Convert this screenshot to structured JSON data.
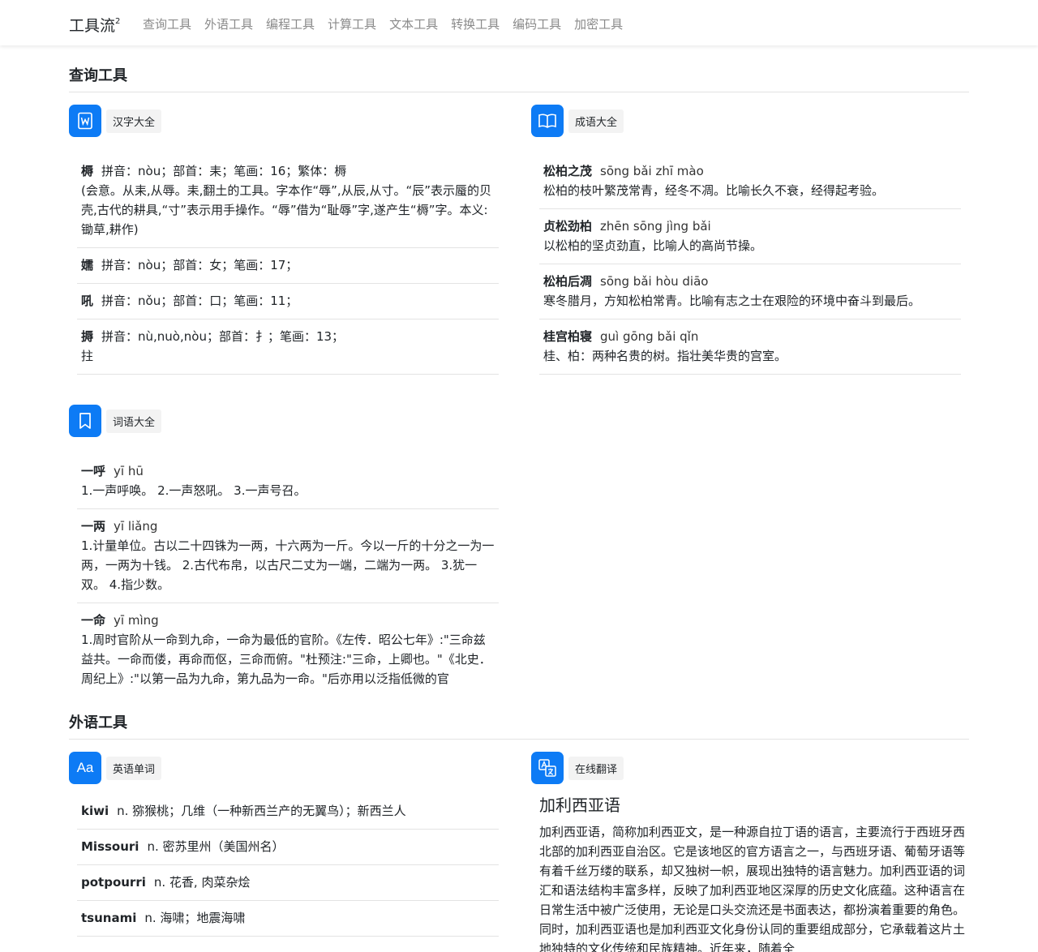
{
  "brand": {
    "name": "工具流",
    "sup": "2"
  },
  "nav": [
    "查询工具",
    "外语工具",
    "编程工具",
    "计算工具",
    "文本工具",
    "转换工具",
    "编码工具",
    "加密工具"
  ],
  "sections": {
    "query": {
      "title": "查询工具"
    },
    "foreign": {
      "title": "外语工具"
    }
  },
  "hanzi": {
    "tag": "汉字大全",
    "entries": [
      {
        "char": "槈",
        "info": "拼音：nòu；部首：耒；笔画：16；繁体：槈",
        "extra": "(会意。从耒,从辱。耒,翻土的工具。字本作“辱”,从辰,从寸。“辰”表示蜃的贝壳,古代的耕具,“寸”表示用手操作。“辱”借为“耻辱”字,遂产生“槈”字。本义:锄草,耕作)"
      },
      {
        "char": "嬬",
        "info": "拼音：nòu；部首：女；笔画：17；",
        "extra": ""
      },
      {
        "char": "吼",
        "info": "拼音：nǒu；部首：口；笔画：11；",
        "extra": ""
      },
      {
        "char": "搙",
        "info": "拼音：nù,nuò,nòu；部首：扌；笔画：13；",
        "extra": "拄"
      }
    ]
  },
  "chengyu": {
    "tag": "成语大全",
    "entries": [
      {
        "word": "松柏之茂",
        "pinyin": "sōng bǎi zhī mào",
        "meaning": "松柏的枝叶繁茂常青，经冬不凋。比喻长久不衰，经得起考验。"
      },
      {
        "word": "贞松劲柏",
        "pinyin": "zhēn sōng jìng bǎi",
        "meaning": "以松柏的坚贞劲直，比喻人的高尚节操。"
      },
      {
        "word": "松柏后凋",
        "pinyin": "sōng bǎi hòu diāo",
        "meaning": "寒冬腊月，方知松柏常青。比喻有志之士在艰险的环境中奋斗到最后。"
      },
      {
        "word": "桂宫柏寝",
        "pinyin": "guì gōng bǎi qǐn",
        "meaning": "桂、柏：两种名贵的树。指壮美华贵的宫室。"
      }
    ]
  },
  "ciyu": {
    "tag": "词语大全",
    "entries": [
      {
        "word": "一呼",
        "pinyin": "yī hū",
        "meaning": "1.一声呼唤。 2.一声怒吼。 3.一声号召。"
      },
      {
        "word": "一两",
        "pinyin": "yī liǎng",
        "meaning": "1.计量单位。古以二十四铢为一两，十六两为一斤。今以一斤的十分之一为一两，一两为十钱。 2.古代布帛，以古尺二丈为一端，二端为一两。 3.犹一双。 4.指少数。"
      },
      {
        "word": "一命",
        "pinyin": "yī mìng",
        "meaning": "1.周时官阶从一命到九命，一命为最低的官阶。《左传．昭公七年》:\"三命兹益共。一命而偻，再命而伛，三命而俯。\"杜预注:\"三命，上卿也。\"《北史．周纪上》:\"以第一品为九命，第九品为一命。\"后亦用以泛指低微的官"
      }
    ]
  },
  "english": {
    "tag": "英语单词",
    "entries": [
      {
        "word": "kiwi",
        "meaning": "n. 猕猴桃；几维（一种新西兰产的无翼鸟）；新西兰人"
      },
      {
        "word": "Missouri",
        "meaning": "n. 密苏里州（美国州名）"
      },
      {
        "word": "potpourri",
        "meaning": "n. 花香, 肉菜杂烩"
      },
      {
        "word": "tsunami",
        "meaning": "n. 海啸；地震海啸"
      }
    ]
  },
  "translate": {
    "tag": "在线翻译",
    "title": "加利西亚语",
    "body": "加利西亚语，简称加利西亚文，是一种源自拉丁语的语言，主要流行于西班牙西北部的加利西亚自治区。它是该地区的官方语言之一，与西班牙语、葡萄牙语等有着千丝万缕的联系，却又独树一帜，展现出独特的语言魅力。加利西亚语的词汇和语法结构丰富多样，反映了加利西亚地区深厚的历史文化底蕴。这种语言在日常生活中被广泛使用，无论是口头交流还是书面表达，都扮演着重要的角色。同时，加利西亚语也是加利西亚文化身份认同的重要组成部分，它承载着这片土地独特的文化传统和民族精神。近年来，随着全"
  },
  "colors": {
    "accent": "#0d7bf5",
    "nav_text": "#8a8a8a",
    "divider": "#e3e3e3"
  }
}
